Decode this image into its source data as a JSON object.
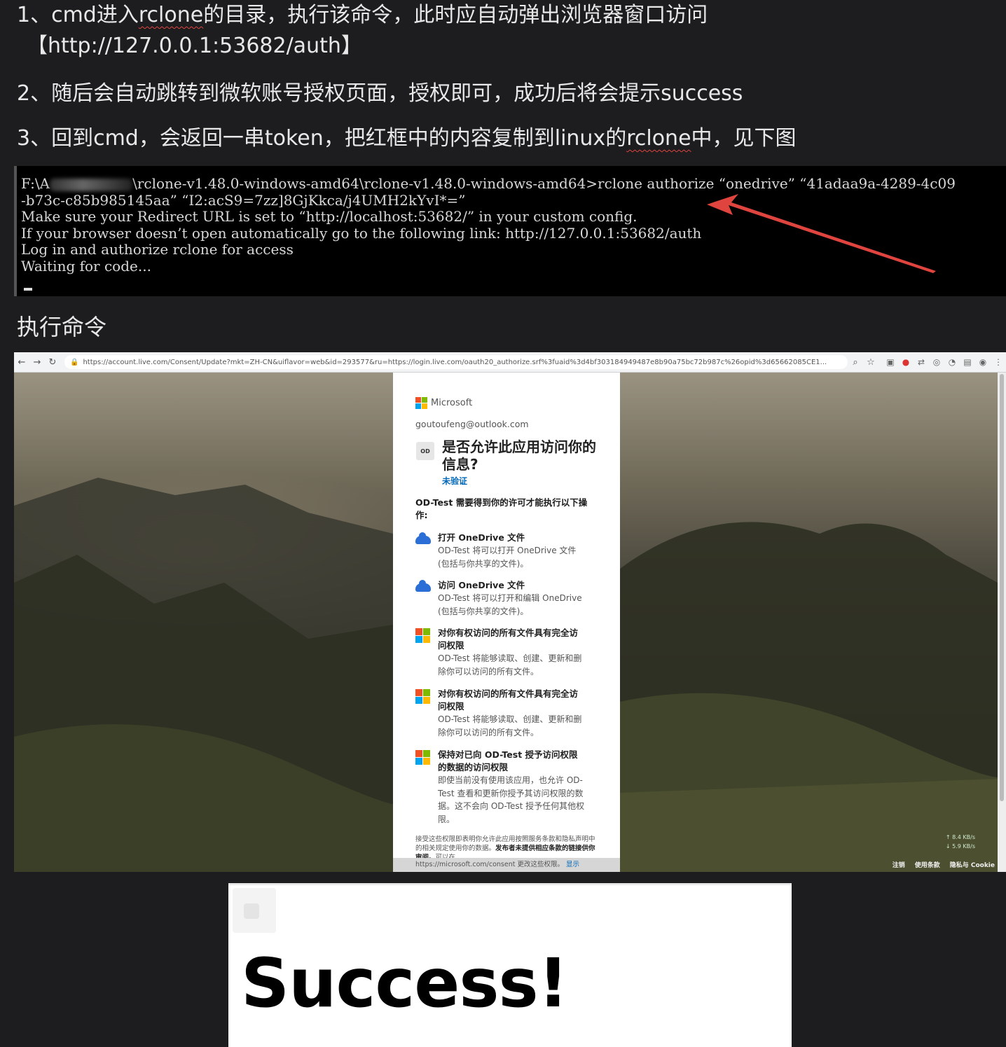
{
  "steps": {
    "s1_prefix": "1、cmd进入",
    "s1_word": "rclone",
    "s1_suffix": "的目录，执行该命令，此时应自动弹出浏览器窗口访问",
    "s1_url": "【http://127.0.0.1:53682/auth】",
    "s2": "2、随后会自动跳转到微软账号授权页面，授权即可，成功后将会提示success",
    "s3_prefix": "3、回到cmd，会返回一串token，把红框中的内容复制到linux的",
    "s3_word": "rclone",
    "s3_suffix": "中，见下图"
  },
  "terminal": {
    "line1_a": "F:\\A",
    "line1_b": "\\rclone-v1.48.0-windows-amd64\\rclone-v1.48.0-windows-amd64>rclone authorize “onedrive” “41adaa9a-4289-4c09",
    "line2": "-b73c-c85b985145aa” “I2:acS9=7zz]8GjKkca/j4UMH2kYvI*=”",
    "line3": "Make sure your Redirect URL is set to “http://localhost:53682/” in your custom config.",
    "line4": "If your browser doesn’t open automatically go to the following link: http://127.0.0.1:53682/auth",
    "line5": "Log in and authorize rclone for access",
    "line6": "Waiting for code..."
  },
  "caption": "执行命令",
  "browser": {
    "url": "https://account.live.com/Consent/Update?mkt=ZH-CN&uiflavor=web&id=293577&ru=https://login.live.com/oauth20_authorize.srf%3fuaid%3d4bf303184949487e8b90a75bc72b987c%26opid%3d65662085CE1...",
    "dialog": {
      "brand": "Microsoft",
      "email": "goutoufeng@outlook.com",
      "badge": "OD",
      "title": "是否允许此应用访问你的信息?",
      "unverified": "未验证",
      "intro": "OD-Test 需要得到你的许可才能执行以下操作:",
      "permissions": [
        {
          "icon": "onedrive-cloud-icon",
          "title": "打开 OneDrive 文件",
          "desc": "OD-Test 将可以打开 OneDrive 文件(包括与你共享的文件)。"
        },
        {
          "icon": "onedrive-cloud-icon",
          "title": "访问 OneDrive 文件",
          "desc": "OD-Test 将可以打开和编辑 OneDrive (包括与你共享的文件)。"
        },
        {
          "icon": "microsoft-logo-icon",
          "title": "对你有权访问的所有文件具有完全访问权限",
          "desc": "OD-Test 将能够读取、创建、更新和删除你可以访问的所有文件。"
        },
        {
          "icon": "microsoft-logo-icon",
          "title": "对你有权访问的所有文件具有完全访问权限",
          "desc": "OD-Test 将能够读取、创建、更新和删除你可以访问的所有文件。"
        },
        {
          "icon": "microsoft-logo-icon",
          "title": "保持对已向 OD-Test 授予访问权限的数据的访问权限",
          "desc": "即使当前没有使用该应用，也允许 OD-Test 查看和更新你授予其访问权限的数据。这不会向 OD-Test 授予任何其他权限。"
        }
      ],
      "footer_a": "接受这些权限即表明你允许此应用按照服务条款和隐私声明中的相关规定使用你的数据。",
      "footer_b": "发布者未提供相应条款的链接供你审阅。",
      "footer_c": "可以在",
      "bottom_text": "https://microsoft.com/consent 更改这些权限。",
      "bottom_link": "显示"
    },
    "netspeed_up": "↑ 8.4 KB/s",
    "netspeed_down": "↓ 5.9 KB/s",
    "links": [
      "注销",
      "使用条款",
      "隐私与 Cookie"
    ]
  },
  "success": "Success!",
  "colors": {
    "page_bg": "#1d1d1f",
    "arrow_red": "#e0443e",
    "ms_red": "#f25022",
    "ms_green": "#7fba00",
    "ms_blue": "#00a4ef",
    "ms_yellow": "#ffb900",
    "link_blue": "#0067b8"
  }
}
